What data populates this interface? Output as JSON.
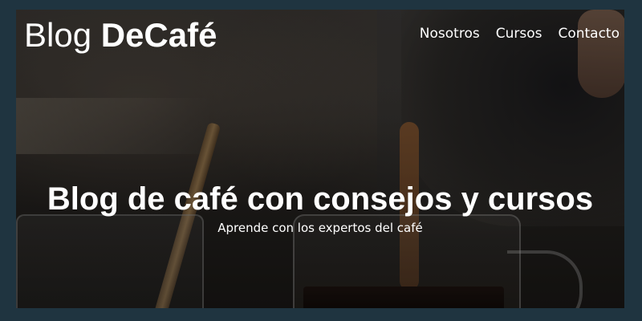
{
  "header": {
    "logo_regular": "Blog ",
    "logo_bold": "DeCafé"
  },
  "nav": {
    "items": [
      {
        "label": "Nosotros"
      },
      {
        "label": "Cursos"
      },
      {
        "label": "Contacto"
      }
    ]
  },
  "hero": {
    "title": "Blog de café con consejos y cursos",
    "subtitle": "Aprende con los expertos del café"
  },
  "colors": {
    "page_background": "#1f3440",
    "text": "#ffffff"
  }
}
